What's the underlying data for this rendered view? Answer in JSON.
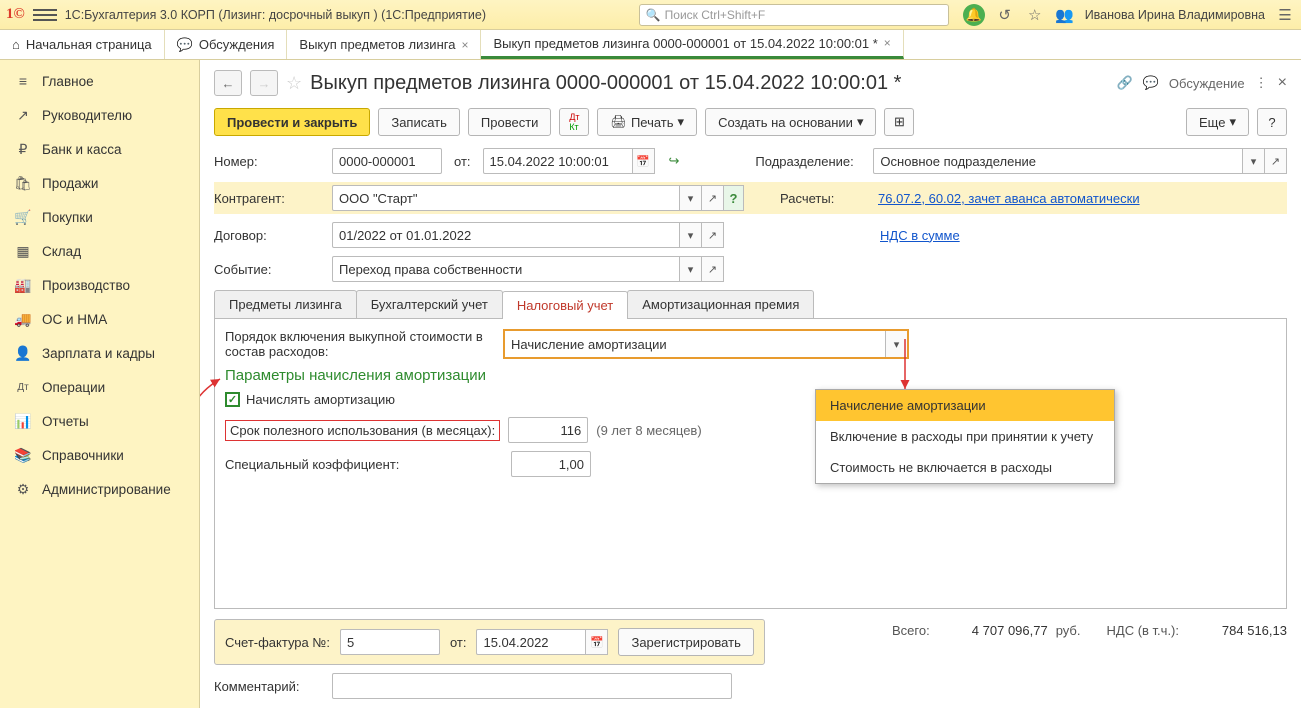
{
  "titlebar": {
    "app_title": "1С:Бухгалтерия 3.0 КОРП (Лизинг: досрочный выкуп )  (1С:Предприятие)",
    "search_placeholder": "Поиск Ctrl+Shift+F",
    "user": "Иванова Ирина Владимировна"
  },
  "tabs": [
    {
      "label": "Начальная страница",
      "icon": "home"
    },
    {
      "label": "Обсуждения",
      "icon": "chat"
    },
    {
      "label": "Выкуп предметов лизинга",
      "closable": true
    },
    {
      "label": "Выкуп предметов лизинга 0000-000001 от 15.04.2022 10:00:01 *",
      "closable": true,
      "active": true
    }
  ],
  "sidebar": [
    {
      "icon": "≡",
      "label": "Главное"
    },
    {
      "icon": "↗",
      "label": "Руководителю"
    },
    {
      "icon": "₽",
      "label": "Банк и касса"
    },
    {
      "icon": "🛍",
      "label": "Продажи"
    },
    {
      "icon": "🛒",
      "label": "Покупки"
    },
    {
      "icon": "▦",
      "label": "Склад"
    },
    {
      "icon": "🏭",
      "label": "Производство"
    },
    {
      "icon": "🚚",
      "label": "ОС и НМА"
    },
    {
      "icon": "👤",
      "label": "Зарплата и кадры"
    },
    {
      "icon": "Дт",
      "label": "Операции"
    },
    {
      "icon": "📊",
      "label": "Отчеты"
    },
    {
      "icon": "📚",
      "label": "Справочники"
    },
    {
      "icon": "⚙",
      "label": "Администрирование"
    }
  ],
  "doc": {
    "title": "Выкуп предметов лизинга 0000-000001 от 15.04.2022 10:00:01 *",
    "discuss": "Обсуждение"
  },
  "toolbar": {
    "post_close": "Провести и закрыть",
    "write": "Записать",
    "post": "Провести",
    "print": "Печать",
    "create_based": "Создать на основании",
    "more": "Еще"
  },
  "form": {
    "number_label": "Номер:",
    "number": "0000-000001",
    "from_label": "от:",
    "date": "15.04.2022 10:00:01",
    "subdiv_label": "Подразделение:",
    "subdiv": "Основное подразделение",
    "contractor_label": "Контрагент:",
    "contractor": "ООО \"Старт\"",
    "calc_label": "Расчеты:",
    "calc_link": "76.07.2, 60.02, зачет аванса автоматически",
    "contract_label": "Договор:",
    "contract": "01/2022 от 01.01.2022",
    "vat_link": "НДС в сумме",
    "event_label": "Событие:",
    "event": "Переход права собственности"
  },
  "inner_tabs": [
    "Предметы лизинга",
    "Бухгалтерский учет",
    "Налоговый учет",
    "Амортизационная премия"
  ],
  "tax_tab": {
    "order_label": "Порядок включения выкупной стоимости в состав расходов:",
    "order_value": "Начисление амортизации",
    "section": "Параметры начисления амортизации",
    "amort_cb": "Начислять амортизацию",
    "life_label": "Срок полезного использования (в месяцах):",
    "life_value": "116",
    "life_hint": "(9 лет 8 месяцев)",
    "coef_label": "Специальный коэффициент:",
    "coef_value": "1,00"
  },
  "dropdown": {
    "opt1": "Начисление амортизации",
    "opt2": "Включение в расходы при принятии к учету",
    "opt3": "Стоимость не включается в расходы"
  },
  "footer": {
    "invoice_label": "Счет-фактура №:",
    "invoice_no": "5",
    "invoice_from": "от:",
    "invoice_date": "15.04.2022",
    "register": "Зарегистрировать",
    "total_label": "Всего:",
    "total": "4 707 096,77",
    "currency": "руб.",
    "vat_label": "НДС (в т.ч.):",
    "vat": "784 516,13",
    "comment_label": "Комментарий:"
  }
}
